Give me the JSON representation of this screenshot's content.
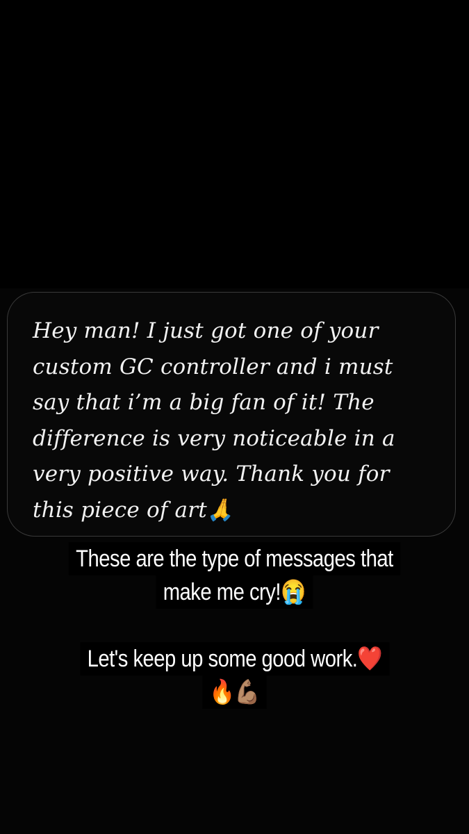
{
  "message": {
    "text": "Hey man! I just got one of your custom GC controller and i must say that i’m a big fan of it! The difference is very noticeable in a very positive way. Thank you for this piece of art🙏"
  },
  "caption": {
    "line1": "These are the type of messages that",
    "line2": "make me cry!😭",
    "line3": "Let's keep up some good work.❤️",
    "line4": "🔥💪🏽"
  }
}
